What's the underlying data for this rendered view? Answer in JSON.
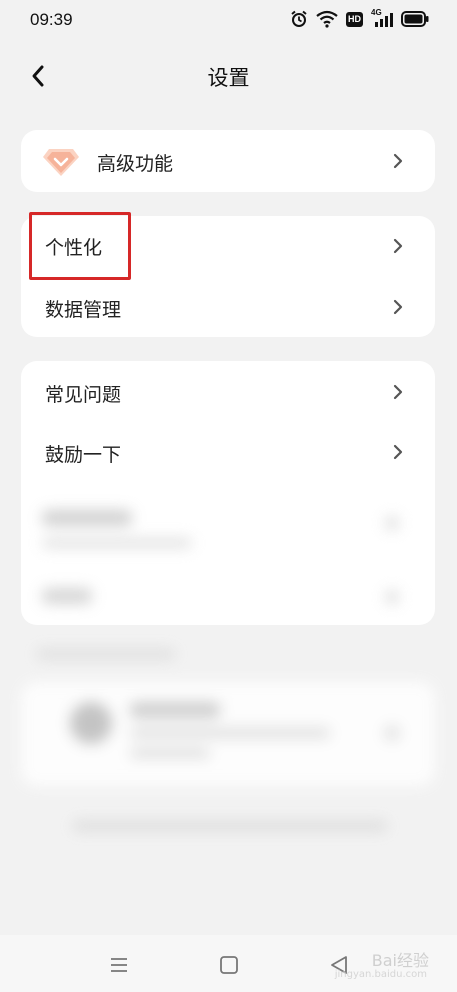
{
  "status_bar": {
    "time": "09:39",
    "icons": [
      "alarm-icon",
      "wifi-icon",
      "hd-icon",
      "signal-4g-icon",
      "battery-icon"
    ],
    "hd_label": "HD",
    "net_label": "4G"
  },
  "header": {
    "title": "设置",
    "back_icon": "chevron-left-icon"
  },
  "premium_card": {
    "label": "高级功能",
    "icon": "diamond-icon",
    "icon_color": "#f3a07c"
  },
  "settings_group_1": {
    "items": [
      {
        "label": "个性化"
      },
      {
        "label": "数据管理"
      }
    ]
  },
  "settings_group_2": {
    "items": [
      {
        "label": "常见问题"
      },
      {
        "label": "鼓励一下"
      }
    ]
  },
  "highlight": {
    "color": "#d62828"
  },
  "nav_bar": {
    "icons": [
      "menu-icon",
      "home-icon",
      "back-icon"
    ]
  },
  "watermark": {
    "text": "Bai经验",
    "sub": "jingyan.baidu.com"
  }
}
